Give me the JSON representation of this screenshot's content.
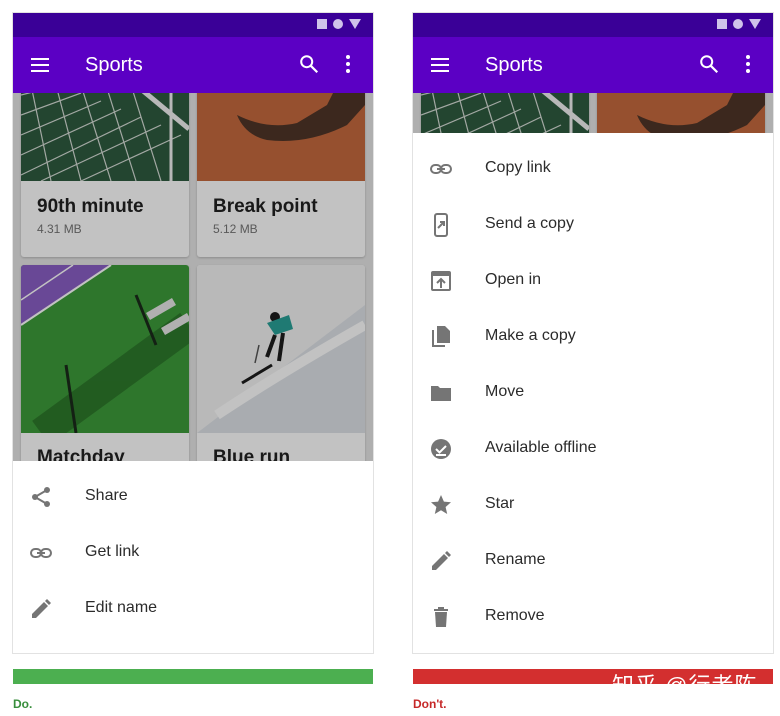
{
  "left_phone": {
    "title": "Sports",
    "cards": [
      {
        "name": "90th minute",
        "size": "4.31 MB"
      },
      {
        "name": "Break point",
        "size": "5.12 MB"
      },
      {
        "name": "Matchday",
        "size": ""
      },
      {
        "name": "Blue run",
        "size": ""
      }
    ],
    "sheet_items": [
      {
        "icon": "share-icon",
        "label": "Share"
      },
      {
        "icon": "link-icon",
        "label": "Get link"
      },
      {
        "icon": "pencil-icon",
        "label": "Edit name"
      }
    ]
  },
  "right_phone": {
    "title": "Sports",
    "sheet_items": [
      {
        "icon": "link-icon",
        "label": "Copy link"
      },
      {
        "icon": "send-phone-icon",
        "label": "Send a copy"
      },
      {
        "icon": "open-in-icon",
        "label": "Open in"
      },
      {
        "icon": "copy-icon",
        "label": "Make a copy"
      },
      {
        "icon": "folder-icon",
        "label": "Move"
      },
      {
        "icon": "offline-check-icon",
        "label": "Available offline"
      },
      {
        "icon": "star-icon",
        "label": "Star"
      },
      {
        "icon": "pencil-icon",
        "label": "Rename"
      },
      {
        "icon": "trash-icon",
        "label": "Remove"
      }
    ]
  },
  "captions": {
    "do": "Do.",
    "dont": "Don't."
  },
  "watermark": "知乎 @行者陈",
  "colors": {
    "status_bar": "#3a0097",
    "app_bar": "#5b00c4",
    "do_bar": "#4caf50",
    "dont_bar": "#d32f2f",
    "do_text": "#388e3c",
    "dont_text": "#c62828",
    "icon_gray": "#757575"
  }
}
